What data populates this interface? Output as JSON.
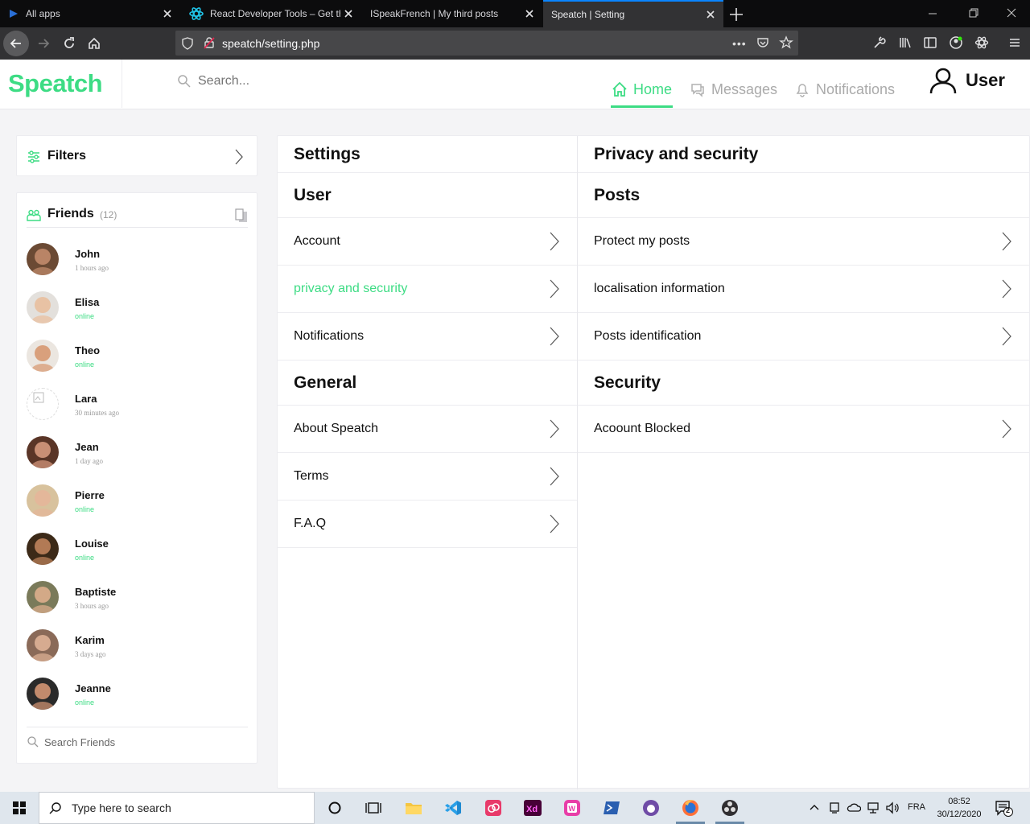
{
  "browser": {
    "tabs": [
      {
        "title": "All apps",
        "icon": "app-icon",
        "active": false
      },
      {
        "title": "React Developer Tools – Get this Extension for Firefox",
        "icon": "react-devtools-icon",
        "active": false
      },
      {
        "title": "ISpeakFrench | My third posts",
        "icon": "",
        "active": false
      },
      {
        "title": "Speatch | Setting",
        "icon": "",
        "active": true
      }
    ],
    "url": "speatch/setting.php"
  },
  "header": {
    "logo": "Speatch",
    "search_placeholder": "Search...",
    "nav": {
      "home": "Home",
      "messages": "Messages",
      "notifications": "Notifications"
    },
    "user": "User"
  },
  "sidebar": {
    "filters_label": "Filters",
    "friends_label": "Friends",
    "friends_count": "(12)",
    "friends": [
      {
        "name": "John",
        "status": "1 hours ago",
        "online": false,
        "bg": "#6b4a34",
        "face": "#b98466"
      },
      {
        "name": "Elisa",
        "status": "online",
        "online": true,
        "bg": "#e3e0dc",
        "face": "#e8c2a4"
      },
      {
        "name": "Theo",
        "status": "online",
        "online": true,
        "bg": "#ebe6e0",
        "face": "#d9a07c"
      },
      {
        "name": "Lara",
        "status": "30 minutes ago",
        "online": false,
        "bg": "#ffffff",
        "face": "#ffffff"
      },
      {
        "name": "Jean",
        "status": "1 day ago",
        "online": false,
        "bg": "#5a3527",
        "face": "#c98f75"
      },
      {
        "name": "Pierre",
        "status": "online",
        "online": true,
        "bg": "#d8c29d",
        "face": "#e4b79a"
      },
      {
        "name": "Louise",
        "status": "online",
        "online": true,
        "bg": "#3c2a18",
        "face": "#b27a55"
      },
      {
        "name": "Baptiste",
        "status": "3 hours ago",
        "online": false,
        "bg": "#7a7a5a",
        "face": "#d3a987"
      },
      {
        "name": "Karim",
        "status": "3 days ago",
        "online": false,
        "bg": "#8a6a58",
        "face": "#d6ab90"
      },
      {
        "name": "Jeanne",
        "status": "online",
        "online": true,
        "bg": "#2a2a2a",
        "face": "#c28a6c"
      }
    ],
    "search_friends_placeholder": "Search Friends"
  },
  "settings": {
    "left": {
      "title": "Settings",
      "user_section": "User",
      "user_items": [
        "Account",
        "privacy and security",
        "Notifications"
      ],
      "general_section": "General",
      "general_items": [
        "About Speatch",
        "Terms",
        "F.A.Q"
      ]
    },
    "right": {
      "title": "Privacy and security",
      "posts_section": "Posts",
      "posts_items": [
        "Protect my posts",
        "localisation information",
        "Posts identification"
      ],
      "security_section": "Security",
      "security_items": [
        "Acoount Blocked"
      ]
    }
  },
  "taskbar": {
    "search_placeholder": "Type here to search",
    "language": "FRA",
    "time": "08:52",
    "date": "30/12/2020",
    "notification_count": "2"
  },
  "colors": {
    "accent": "#3ddc84",
    "text": "#111111",
    "muted": "#999999"
  }
}
